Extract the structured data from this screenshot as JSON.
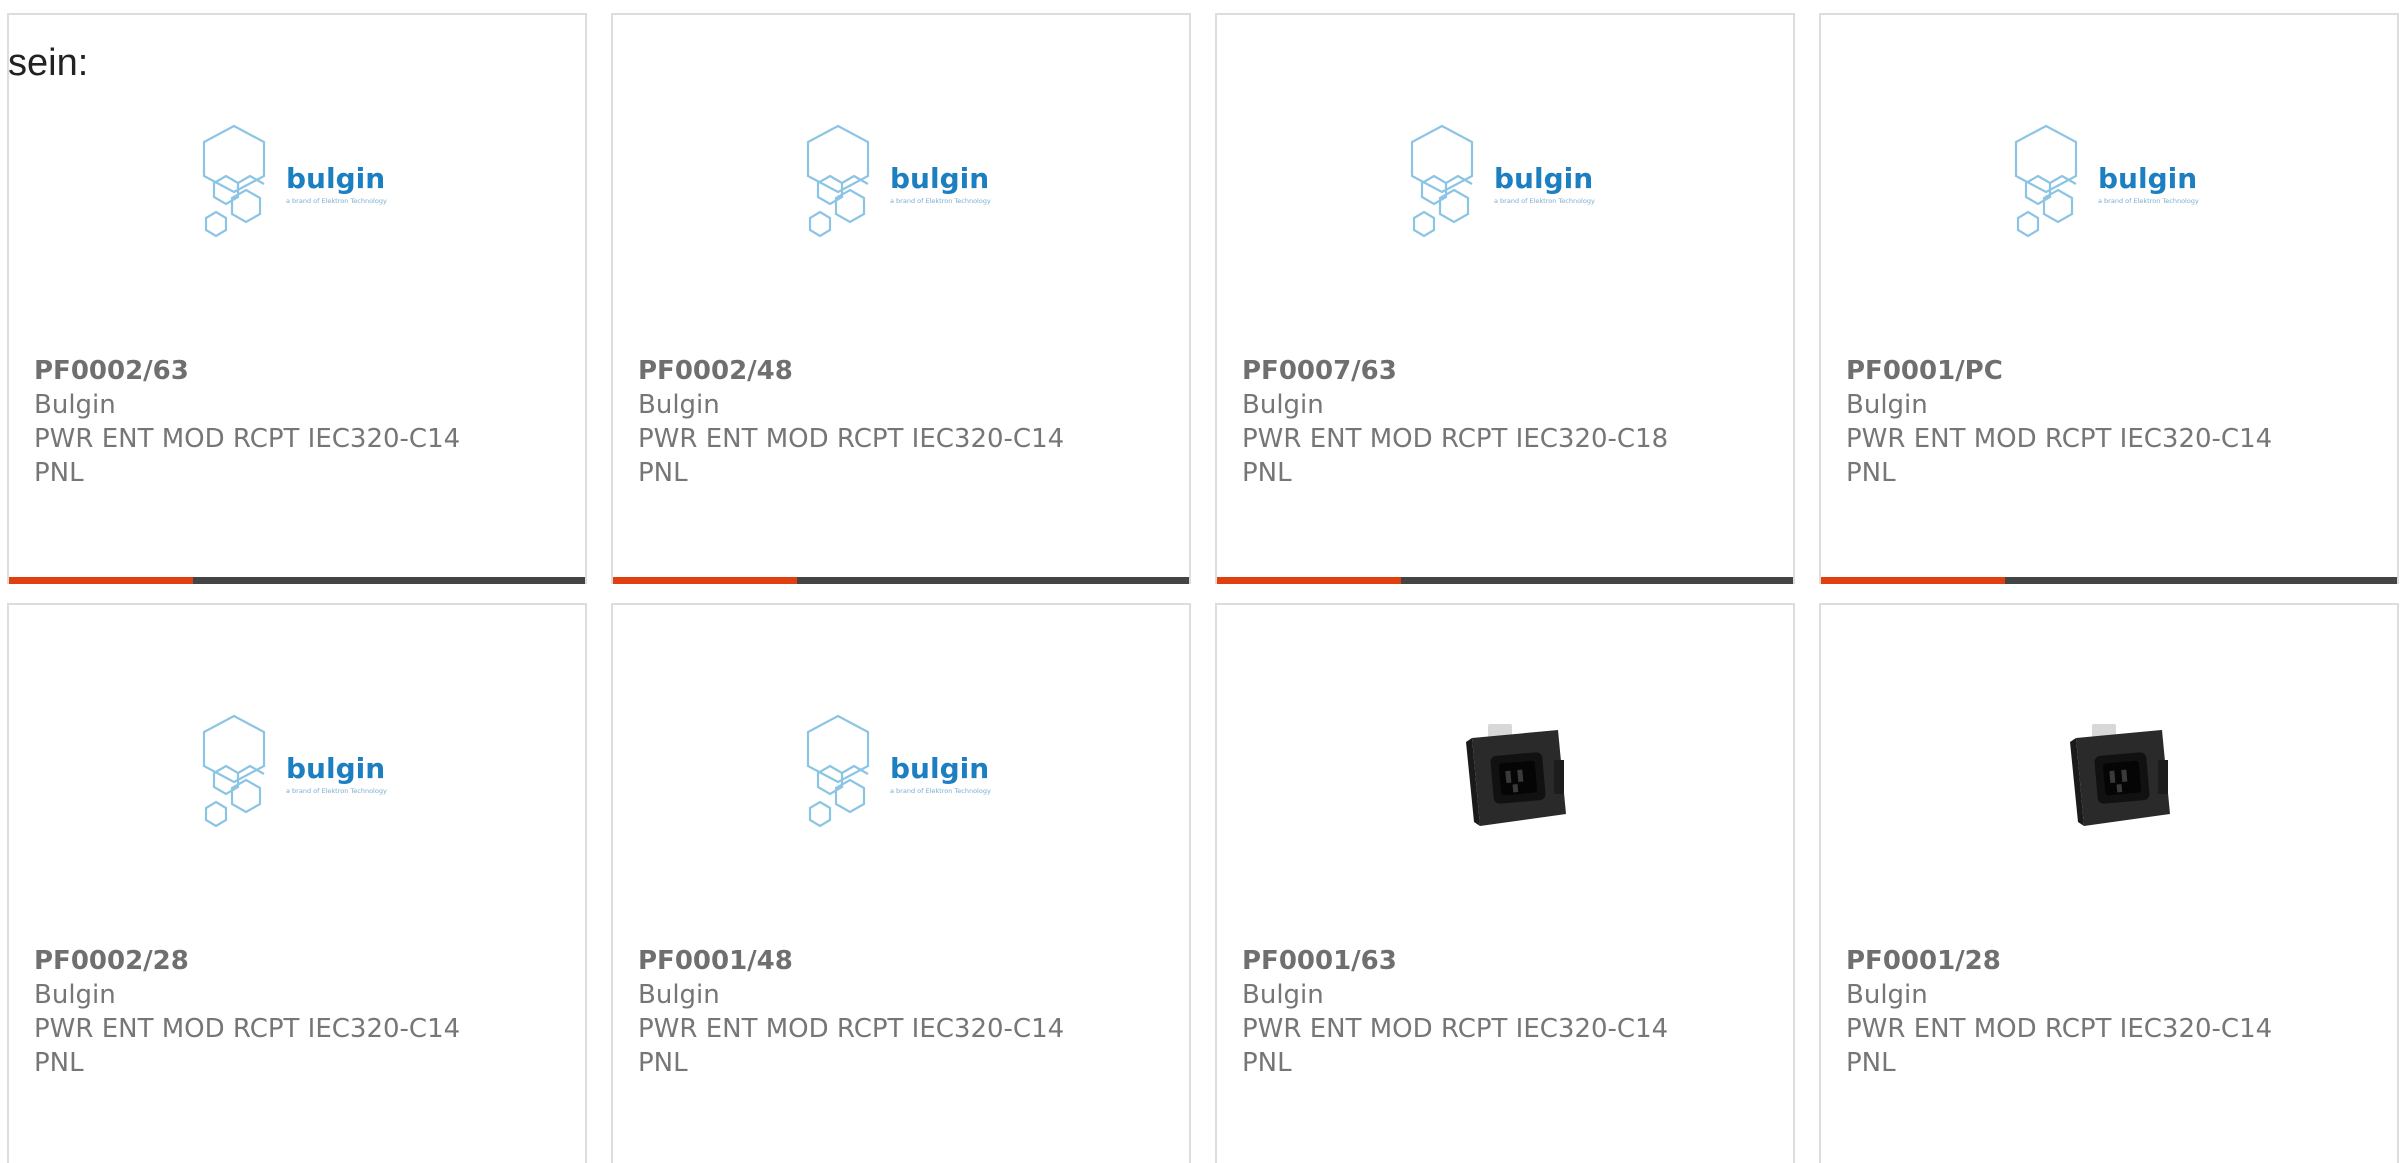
{
  "intro_text": "sein:",
  "colors": {
    "accent": "#e0400f",
    "bar_track": "#444444",
    "brand_blue": "#1b7fc1",
    "hex_outline": "#8cc4e4"
  },
  "products": [
    {
      "part": "PF0002/63",
      "brand": "Bulgin",
      "desc": "PWR ENT MOD RCPT IEC320-C14",
      "desc2": "PNL",
      "image": "bulgin-logo",
      "progress": 0.32
    },
    {
      "part": "PF0002/48",
      "brand": "Bulgin",
      "desc": "PWR ENT MOD RCPT IEC320-C14",
      "desc2": "PNL",
      "image": "bulgin-logo",
      "progress": 0.32
    },
    {
      "part": "PF0007/63",
      "brand": "Bulgin",
      "desc": "PWR ENT MOD RCPT IEC320-C18",
      "desc2": "PNL",
      "image": "bulgin-logo",
      "progress": 0.32
    },
    {
      "part": "PF0001/PC",
      "brand": "Bulgin",
      "desc": "PWR ENT MOD RCPT IEC320-C14",
      "desc2": "PNL",
      "image": "bulgin-logo",
      "progress": 0.32
    },
    {
      "part": "PF0002/28",
      "brand": "Bulgin",
      "desc": "PWR ENT MOD RCPT IEC320-C14",
      "desc2": "PNL",
      "image": "bulgin-logo"
    },
    {
      "part": "PF0001/48",
      "brand": "Bulgin",
      "desc": "PWR ENT MOD RCPT IEC320-C14",
      "desc2": "PNL",
      "image": "bulgin-logo"
    },
    {
      "part": "PF0001/63",
      "brand": "Bulgin",
      "desc": "PWR ENT MOD RCPT IEC320-C14",
      "desc2": "PNL",
      "image": "power-entry-module-photo"
    },
    {
      "part": "PF0001/28",
      "brand": "Bulgin",
      "desc": "PWR ENT MOD RCPT IEC320-C14",
      "desc2": "PNL",
      "image": "power-entry-module-photo"
    }
  ]
}
